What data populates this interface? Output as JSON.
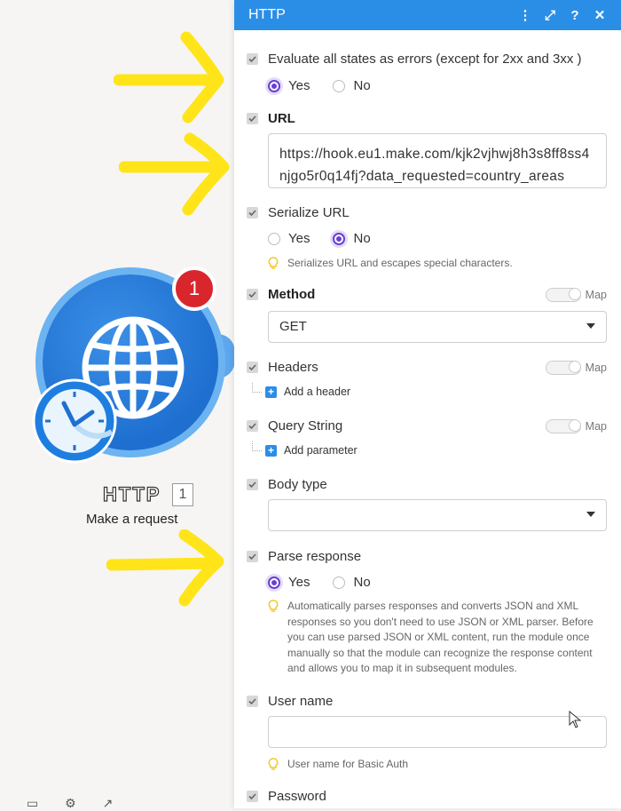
{
  "canvas": {
    "badge_count": "1",
    "module_title": "HTTP",
    "module_number": "1",
    "module_subtitle": "Make a request",
    "colors": {
      "arrow": "#ffe41a",
      "module": "#1f6fd1",
      "badge": "#d9262c"
    }
  },
  "panel": {
    "title": "HTTP",
    "header_icons": [
      "more-vertical-icon",
      "expand-icon",
      "help-icon",
      "close-icon"
    ],
    "header_glyphs": {
      "more": "⋮",
      "expand": "⤢",
      "help": "?",
      "close": "✕"
    },
    "accent": "#2b8ee6",
    "fields": {
      "evaluate": {
        "label": "Evaluate all states as errors (except for 2xx and 3xx )",
        "yes": "Yes",
        "no": "No",
        "selected": "Yes"
      },
      "url": {
        "label": "URL",
        "value": "https://hook.eu1.make.com/kjk2vjhwj8h3s8ff8ss4njgo5r0q14fj?data_requested=country_areas"
      },
      "serialize": {
        "label": "Serialize URL",
        "yes": "Yes",
        "no": "No",
        "selected": "No",
        "hint": "Serializes URL and escapes special characters."
      },
      "method": {
        "label": "Method",
        "map": "Map",
        "value": "GET"
      },
      "headers": {
        "label": "Headers",
        "map": "Map",
        "add": "Add a header"
      },
      "query": {
        "label": "Query String",
        "map": "Map",
        "add": "Add parameter"
      },
      "body_type": {
        "label": "Body type",
        "value": ""
      },
      "parse": {
        "label": "Parse response",
        "yes": "Yes",
        "no": "No",
        "selected": "Yes",
        "hint": "Automatically parses responses and converts JSON and XML responses so you don't need to use JSON or XML parser. Before you can use parsed JSON or XML content, run the module once manually so that the module can recognize the response content and allows you to map it in subsequent modules."
      },
      "username": {
        "label": "User name",
        "value": "",
        "hint": "User name for Basic Auth"
      },
      "password": {
        "label": "Password"
      }
    }
  }
}
